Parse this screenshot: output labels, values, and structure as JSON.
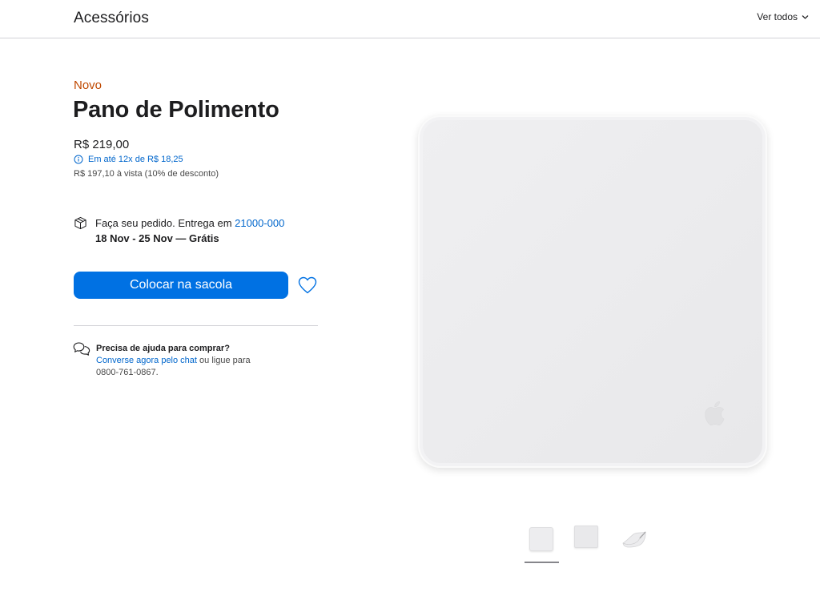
{
  "header": {
    "title": "Acessórios",
    "see_all": "Ver todos"
  },
  "product": {
    "eyebrow": "Novo",
    "title": "Pano de Polimento",
    "price": "R$ 219,00",
    "installments": "Em até 12x de R$ 18,25",
    "cash_price": "R$ 197,10 à vista (10% de desconto)"
  },
  "delivery": {
    "prefix": "Faça seu pedido. Entrega em ",
    "zip": "21000-000",
    "dates": "18 Nov - 25 Nov — Grátis"
  },
  "actions": {
    "add_to_bag": "Colocar na sacola"
  },
  "help": {
    "title": "Precisa de ajuda para comprar?",
    "chat_link": "Converse agora pelo chat",
    "or_call": " ou ligue para",
    "phone": "0800-761-0867."
  },
  "gallery": {
    "selected_index": 0,
    "thumbnails": [
      "thumbnail-1",
      "thumbnail-2",
      "thumbnail-3"
    ]
  },
  "colors": {
    "accent_blue": "#0071e3",
    "link_blue": "#0066cc",
    "new_orange": "#bf4800"
  },
  "icons": [
    "chevron-down-icon",
    "info-icon",
    "box-icon",
    "heart-icon",
    "chat-icon",
    "apple-logo-icon"
  ]
}
